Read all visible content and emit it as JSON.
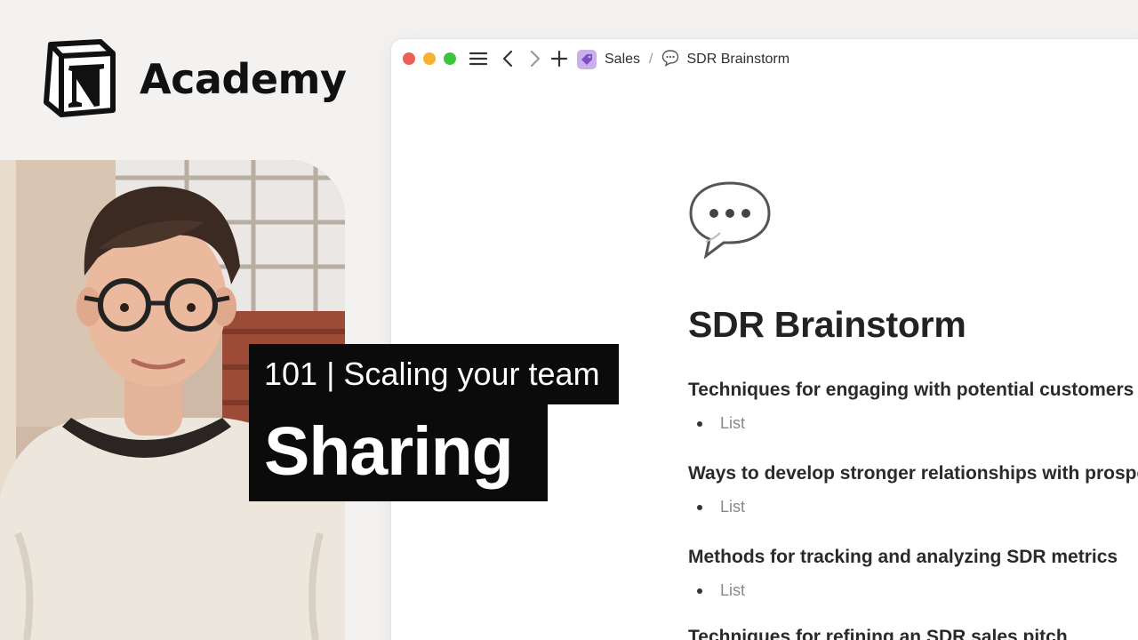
{
  "brand": {
    "logo_icon": "notion-logo-icon",
    "name": "Academy"
  },
  "presenter": {
    "image": "presenter-photo"
  },
  "window": {
    "controls": [
      "close-dot",
      "minimize-dot",
      "maximize-dot"
    ],
    "toolbar_icons": [
      "sidebar-menu-icon",
      "back-chevron-icon",
      "forward-chevron-icon",
      "new-page-plus-icon"
    ],
    "breadcrumb": {
      "parent_icon": "price-tag-icon",
      "parent": "Sales",
      "separator": "/",
      "current_icon": "speech-bubble-icon",
      "current": "SDR Brainstorm"
    },
    "page": {
      "emoji": "speech-bubble-icon",
      "title": "SDR Brainstorm",
      "sections": [
        {
          "heading": "Techniques for engaging with potential customers",
          "items": [
            "List"
          ]
        },
        {
          "heading": "Ways to develop stronger relationships with prospects",
          "items": [
            "List"
          ]
        },
        {
          "heading": "Methods for tracking and analyzing SDR metrics",
          "items": [
            "List"
          ]
        },
        {
          "heading": "Techniques for refining an SDR sales pitch",
          "items": []
        }
      ]
    }
  },
  "lower_third": {
    "course": "101 | Scaling your team",
    "lesson": "Sharing"
  },
  "colors": {
    "background": "#f3f2f0",
    "caption_bg": "#0b0b0b",
    "traffic_red": "#ec5f56",
    "traffic_yellow": "#f5b32f",
    "traffic_green": "#3dc43f",
    "tag": "#c9b0e8"
  }
}
